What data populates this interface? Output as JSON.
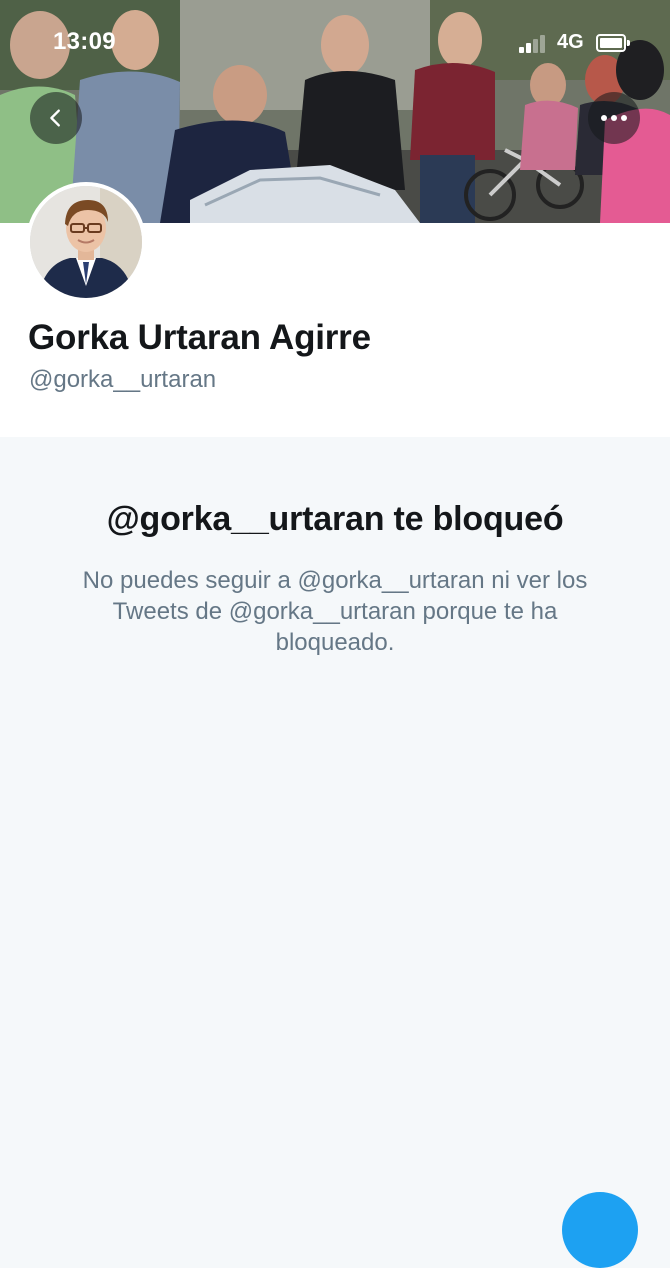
{
  "status_bar": {
    "time": "13:09",
    "network": "4G"
  },
  "header": {
    "back_icon": "chevron-left-icon",
    "more_icon": "more-horizontal-icon"
  },
  "profile": {
    "name": "Gorka Urtaran Agirre",
    "handle": "@gorka__urtaran"
  },
  "blocked": {
    "title": "@gorka__urtaran te bloqueó",
    "message": "No puedes seguir a @gorka__urtaran ni ver los Tweets de @gorka__urtaran porque te ha bloqueado."
  },
  "colors": {
    "accent": "#1da1f2",
    "text_primary": "#14171a",
    "text_secondary": "#657786",
    "background": "#f5f8fa"
  },
  "fab": {
    "icon": "compose-icon"
  }
}
